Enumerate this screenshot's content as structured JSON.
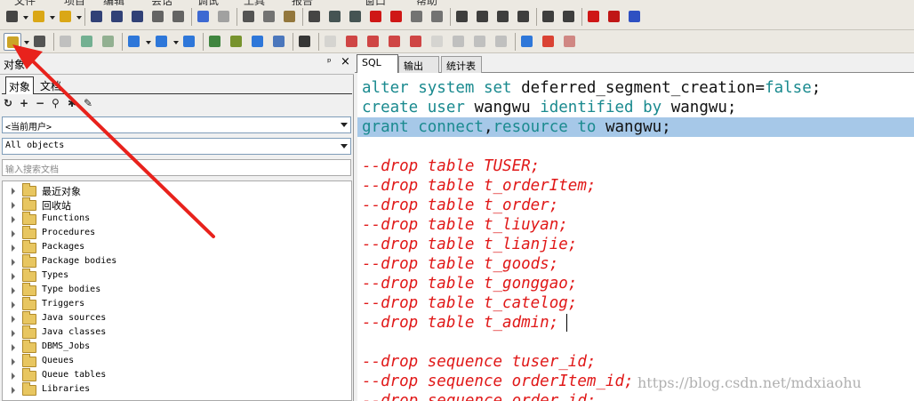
{
  "menu": {
    "items": [
      "文件",
      "项目",
      "编辑",
      "会话",
      "调试",
      "工具",
      "报告",
      "窗口",
      "帮助"
    ]
  },
  "left_panel": {
    "title": "对象",
    "pin_glyph": "ᵖ",
    "close_glyph": "×",
    "tabs": [
      "对象",
      "文档"
    ],
    "tool_glyphs": [
      "↻",
      "+",
      "−",
      "⚲",
      "✱",
      "✎"
    ],
    "user_select": "<当前用户>",
    "filter_select": "All objects",
    "search_placeholder": "输入搜索文档",
    "tree": [
      "最近对象",
      "回收站",
      "Functions",
      "Procedures",
      "Packages",
      "Package bodies",
      "Types",
      "Type bodies",
      "Triggers",
      "Java sources",
      "Java classes",
      "DBMS_Jobs",
      "Queues",
      "Queue tables",
      "Libraries"
    ]
  },
  "editor": {
    "tabs": [
      "SQL",
      "输出",
      "统计表"
    ],
    "lines": [
      {
        "tokens": [
          {
            "t": "alter system set",
            "c": "kw"
          },
          {
            "t": " deferred_segment_creation=",
            "c": "pl"
          },
          {
            "t": "false",
            "c": "kw"
          },
          {
            "t": ";",
            "c": "pl"
          }
        ]
      },
      {
        "tokens": [
          {
            "t": "create user",
            "c": "kw"
          },
          {
            "t": " wangwu ",
            "c": "pl"
          },
          {
            "t": "identified by",
            "c": "kw"
          },
          {
            "t": " wangwu;",
            "c": "pl"
          }
        ]
      },
      {
        "tokens": [
          {
            "t": "grant connect",
            "c": "kw"
          },
          {
            "t": ",",
            "c": "pl"
          },
          {
            "t": "resource to",
            "c": "kw"
          },
          {
            "t": " wangwu;",
            "c": "pl"
          }
        ],
        "highlight": true
      },
      {
        "tokens": [
          {
            "t": "",
            "c": "pl"
          }
        ]
      },
      {
        "tokens": [
          {
            "t": "--drop table TUSER;",
            "c": "cm"
          }
        ]
      },
      {
        "tokens": [
          {
            "t": "--drop table t_orderItem;",
            "c": "cm"
          }
        ]
      },
      {
        "tokens": [
          {
            "t": "--drop table t_order;",
            "c": "cm"
          }
        ]
      },
      {
        "tokens": [
          {
            "t": "--drop table t_liuyan;",
            "c": "cm"
          }
        ]
      },
      {
        "tokens": [
          {
            "t": "--drop table t_lianjie;",
            "c": "cm"
          }
        ]
      },
      {
        "tokens": [
          {
            "t": "--drop table t_goods;",
            "c": "cm"
          }
        ]
      },
      {
        "tokens": [
          {
            "t": "--drop table t_gonggao;",
            "c": "cm"
          }
        ]
      },
      {
        "tokens": [
          {
            "t": "--drop table t_catelog;",
            "c": "cm"
          }
        ]
      },
      {
        "tokens": [
          {
            "t": "--drop table t_admin;",
            "c": "cm"
          }
        ]
      },
      {
        "tokens": [
          {
            "t": "",
            "c": "pl"
          }
        ]
      },
      {
        "tokens": [
          {
            "t": "--drop sequence tuser_id;",
            "c": "cm"
          }
        ]
      },
      {
        "tokens": [
          {
            "t": "--drop sequence orderItem_id;",
            "c": "cm"
          }
        ]
      },
      {
        "tokens": [
          {
            "t": "--drop sequence order_id;",
            "c": "cm"
          }
        ]
      }
    ]
  },
  "watermark": "https://blog.csdn.net/mdxiaohu",
  "colors": {
    "keyword": "#1a8a8f",
    "comment": "#e01818",
    "selection": "#a6c8e8",
    "annotation_arrow": "#e8221c"
  },
  "toolbar1_icons": [
    "new-file-icon",
    "open-icon",
    "open-project-icon",
    "save-icon",
    "save-all-icon",
    "save-as-icon",
    "print-icon",
    "print-preview-icon",
    "undo-icon",
    "redo-icon",
    "cut-icon",
    "copy-icon",
    "paste-icon",
    "find-icon",
    "indent-icon",
    "unindent-icon",
    "comment-icon",
    "uncomment-icon",
    "format-icon",
    "format2-icon",
    "sql-window-icon",
    "command-window-icon",
    "test-window-icon",
    "report-window-icon",
    "cascade-windows-icon",
    "tile-windows-icon",
    "oracle-icon",
    "pdf-icon",
    "help-icon"
  ],
  "toolbar2_icons": [
    "logon-icon",
    "execute-gear-icon",
    "break-icon",
    "commit-icon",
    "rollback-icon",
    "sql-icon",
    "explain-plan-icon",
    "sessions-icon",
    "connection-icon",
    "report-icon",
    "sessions-list-icon",
    "database-icon",
    "preferences-wrench-icon",
    "build-icon",
    "compile-icon",
    "run-icon",
    "pause-icon",
    "stop-icon",
    "step-icon",
    "step-over-icon",
    "step-into-icon",
    "step-out-icon",
    "next-arrow-icon",
    "prev-arrow-icon",
    "kill-icon"
  ]
}
